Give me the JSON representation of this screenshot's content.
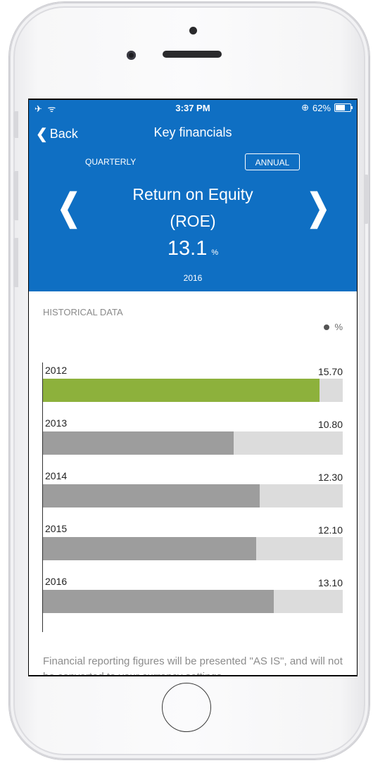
{
  "status": {
    "left_icons": "✈ ᯤ",
    "time": "3:37 PM",
    "lock": "⊕",
    "battery": "62%"
  },
  "nav": {
    "back_label": "Back",
    "title": "Key financials"
  },
  "toggle": {
    "quarterly": "QUARTERLY",
    "annual": "ANNUAL",
    "selected": "ANNUAL"
  },
  "metric": {
    "title_line1": "Return on Equity",
    "title_line2": "(ROE)",
    "value": "13.1",
    "unit": "%",
    "year": "2016"
  },
  "historical": {
    "section_title": "HISTORICAL DATA",
    "legend_label": "%",
    "max_value": 17.0,
    "bars": [
      {
        "year": "2012",
        "value": 15.7,
        "label": "15.70",
        "color": "#8db13c"
      },
      {
        "year": "2013",
        "value": 10.8,
        "label": "10.80",
        "color": "#9d9d9d"
      },
      {
        "year": "2014",
        "value": 12.3,
        "label": "12.30",
        "color": "#9d9d9d"
      },
      {
        "year": "2015",
        "value": 12.1,
        "label": "12.10",
        "color": "#9d9d9d"
      },
      {
        "year": "2016",
        "value": 13.1,
        "label": "13.10",
        "color": "#9d9d9d"
      }
    ]
  },
  "disclaimer": "Financial reporting figures will be presented \"AS IS\", and will not be converted to your currency settings.",
  "colors": {
    "header": "#0f6fc3",
    "highlight": "#8db13c",
    "track": "#dcdcdc"
  },
  "icons": {
    "back": "chevron-left-icon",
    "prev": "chevron-left-icon",
    "next": "chevron-right-icon"
  }
}
